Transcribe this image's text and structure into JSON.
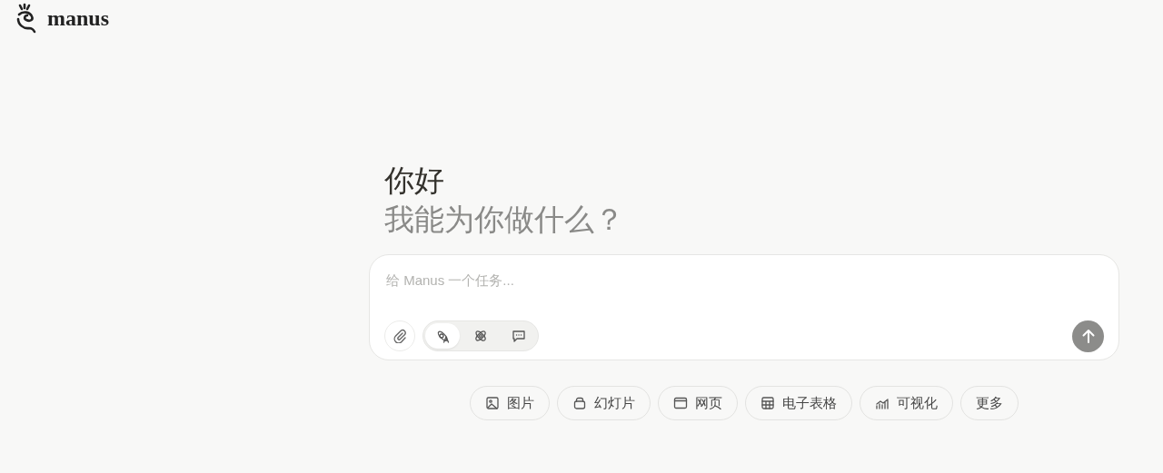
{
  "brand": {
    "name": "manus"
  },
  "greeting": {
    "title": "你好",
    "subtitle": "我能为你做什么？"
  },
  "composer": {
    "placeholder": "给 Manus 一个任务...",
    "modes": [
      {
        "kind": "agent",
        "selected": true
      },
      {
        "kind": "atom",
        "selected": false
      },
      {
        "kind": "chat",
        "selected": false
      }
    ]
  },
  "chips": [
    {
      "kind": "image",
      "label": "图片"
    },
    {
      "kind": "slides",
      "label": "幻灯片"
    },
    {
      "kind": "web",
      "label": "网页"
    },
    {
      "kind": "sheet",
      "label": "电子表格"
    },
    {
      "kind": "chart",
      "label": "可视化"
    },
    {
      "kind": "more",
      "label": "更多"
    }
  ]
}
